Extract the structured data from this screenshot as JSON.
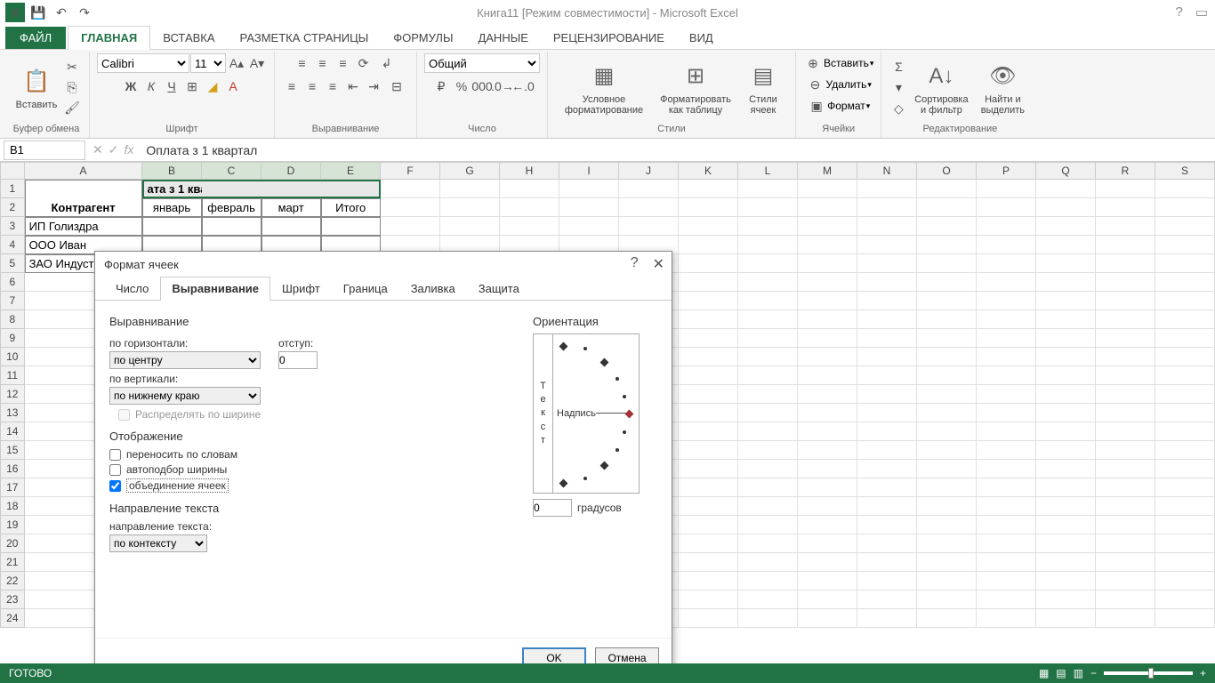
{
  "titlebar": {
    "title": "Книга11 [Режим совместимости] - Microsoft Excel"
  },
  "ribbon_tabs": {
    "file": "ФАЙЛ",
    "tabs": [
      "ГЛАВНАЯ",
      "ВСТАВКА",
      "РАЗМЕТКА СТРАНИЦЫ",
      "ФОРМУЛЫ",
      "ДАННЫЕ",
      "РЕЦЕНЗИРОВАНИЕ",
      "ВИД"
    ],
    "active": 0
  },
  "ribbon": {
    "clipboard": {
      "paste": "Вставить",
      "label": "Буфер обмена"
    },
    "font": {
      "name": "Calibri",
      "size": "11",
      "label": "Шрифт",
      "bold": "Ж",
      "italic": "К",
      "underline": "Ч"
    },
    "align": {
      "label": "Выравнивание"
    },
    "number": {
      "format": "Общий",
      "label": "Число"
    },
    "styles": {
      "cond": "Условное форматирование",
      "table": "Форматировать как таблицу",
      "cell": "Стили ячеек",
      "label": "Стили"
    },
    "cells": {
      "insert": "Вставить",
      "delete": "Удалить",
      "format": "Формат",
      "label": "Ячейки"
    },
    "editing": {
      "sort": "Сортировка и фильтр",
      "find": "Найти и выделить",
      "label": "Редактирование"
    }
  },
  "formula": {
    "name_box": "B1",
    "value": "Оплата з 1 квартал"
  },
  "grid": {
    "cols": [
      "A",
      "B",
      "C",
      "D",
      "E",
      "F",
      "G",
      "H",
      "I",
      "J",
      "K",
      "L",
      "M",
      "N",
      "O",
      "P",
      "Q",
      "R",
      "S"
    ],
    "col_widths": {
      "A": 134,
      "B": 68,
      "C": 68,
      "D": 68,
      "E": 68,
      "default": 68
    },
    "data": {
      "A1": "Контрагент",
      "B1": "ата з 1 квартал",
      "B2": "январь",
      "C2": "февраль",
      "D2": "март",
      "E2": "Итого",
      "A3": "ИП Голиздра",
      "A4": "ООО Иван",
      "A5": "ЗАО Индуст"
    },
    "row_count": 24
  },
  "dialog": {
    "title": "Формат ячеек",
    "tabs": [
      "Число",
      "Выравнивание",
      "Шрифт",
      "Граница",
      "Заливка",
      "Защита"
    ],
    "active_tab": 1,
    "align_section": "Выравнивание",
    "horiz_label": "по горизонтали:",
    "horiz_value": "по центру",
    "indent_label": "отступ:",
    "indent_value": "0",
    "vert_label": "по вертикали:",
    "vert_value": "по нижнему краю",
    "distribute": "Распределять по ширине",
    "display_section": "Отображение",
    "wrap": "переносить по словам",
    "shrink": "автоподбор ширины",
    "merge": "объединение ячеек",
    "direction_section": "Направление текста",
    "direction_label": "направление текста:",
    "direction_value": "по контексту",
    "orient_section": "Ориентация",
    "orient_vert_text": "Текст",
    "orient_label": "Надпись",
    "degrees_value": "0",
    "degrees_label": "градусов",
    "ok": "OK",
    "cancel": "Отмена"
  },
  "statusbar": {
    "ready": "ГОТОВО",
    "zoom": "100%"
  }
}
